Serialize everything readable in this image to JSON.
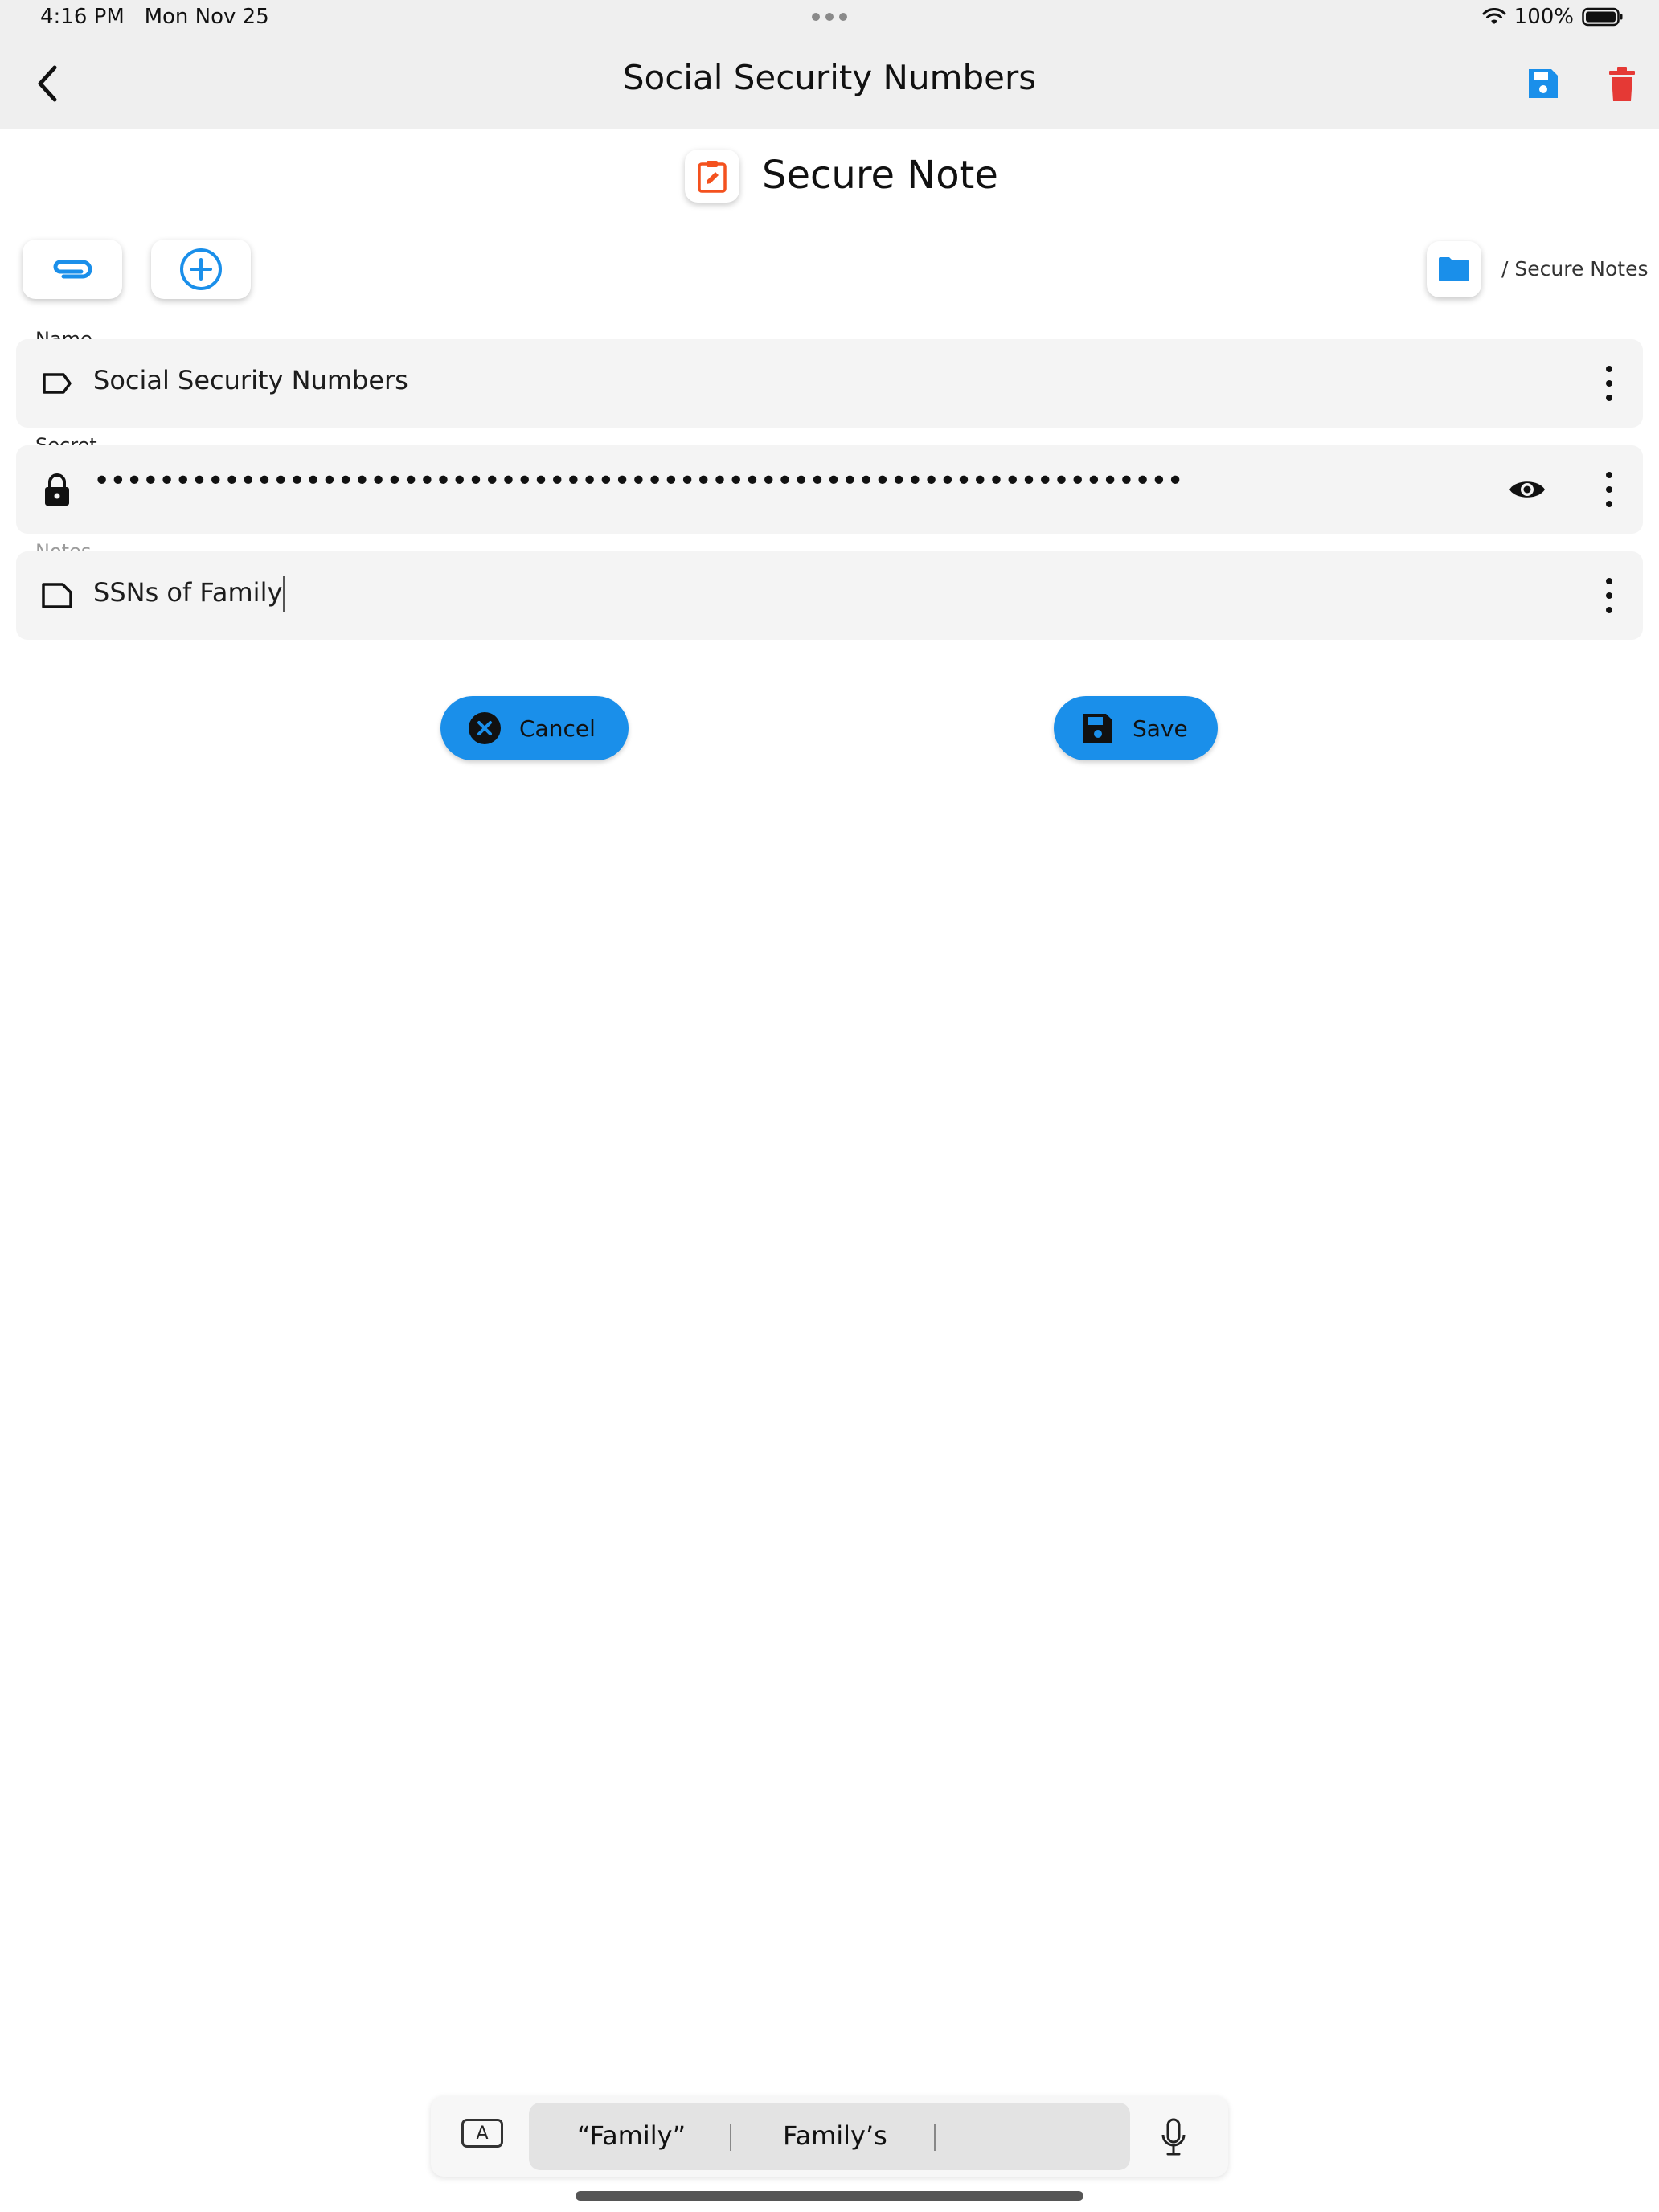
{
  "status_bar": {
    "time": "4:16 PM",
    "date": "Mon Nov 25",
    "battery": "100%"
  },
  "nav": {
    "title": "Social Security Numbers"
  },
  "header": {
    "type_title": "Secure Note"
  },
  "folder": {
    "path": "/ Secure Notes"
  },
  "fields": {
    "name": {
      "label": "Name",
      "value": "Social Security Numbers"
    },
    "secret": {
      "label": "Secret",
      "masked": "•••••••••••••••••••••••••••••••••••••••••••••••••••••••••••••••••••"
    },
    "notes": {
      "label": "Notes",
      "value": "SSNs of Family"
    }
  },
  "actions": {
    "cancel_label": "Cancel",
    "save_label": "Save"
  },
  "keyboard": {
    "key_label": "A",
    "suggestions": [
      "“Family”",
      "Family’s"
    ]
  },
  "colors": {
    "accent": "#1a8fea",
    "delete": "#e53935",
    "note_icon": "#f4511e",
    "field_bg": "#f4f4f4",
    "topbar_bg": "#efefef"
  }
}
